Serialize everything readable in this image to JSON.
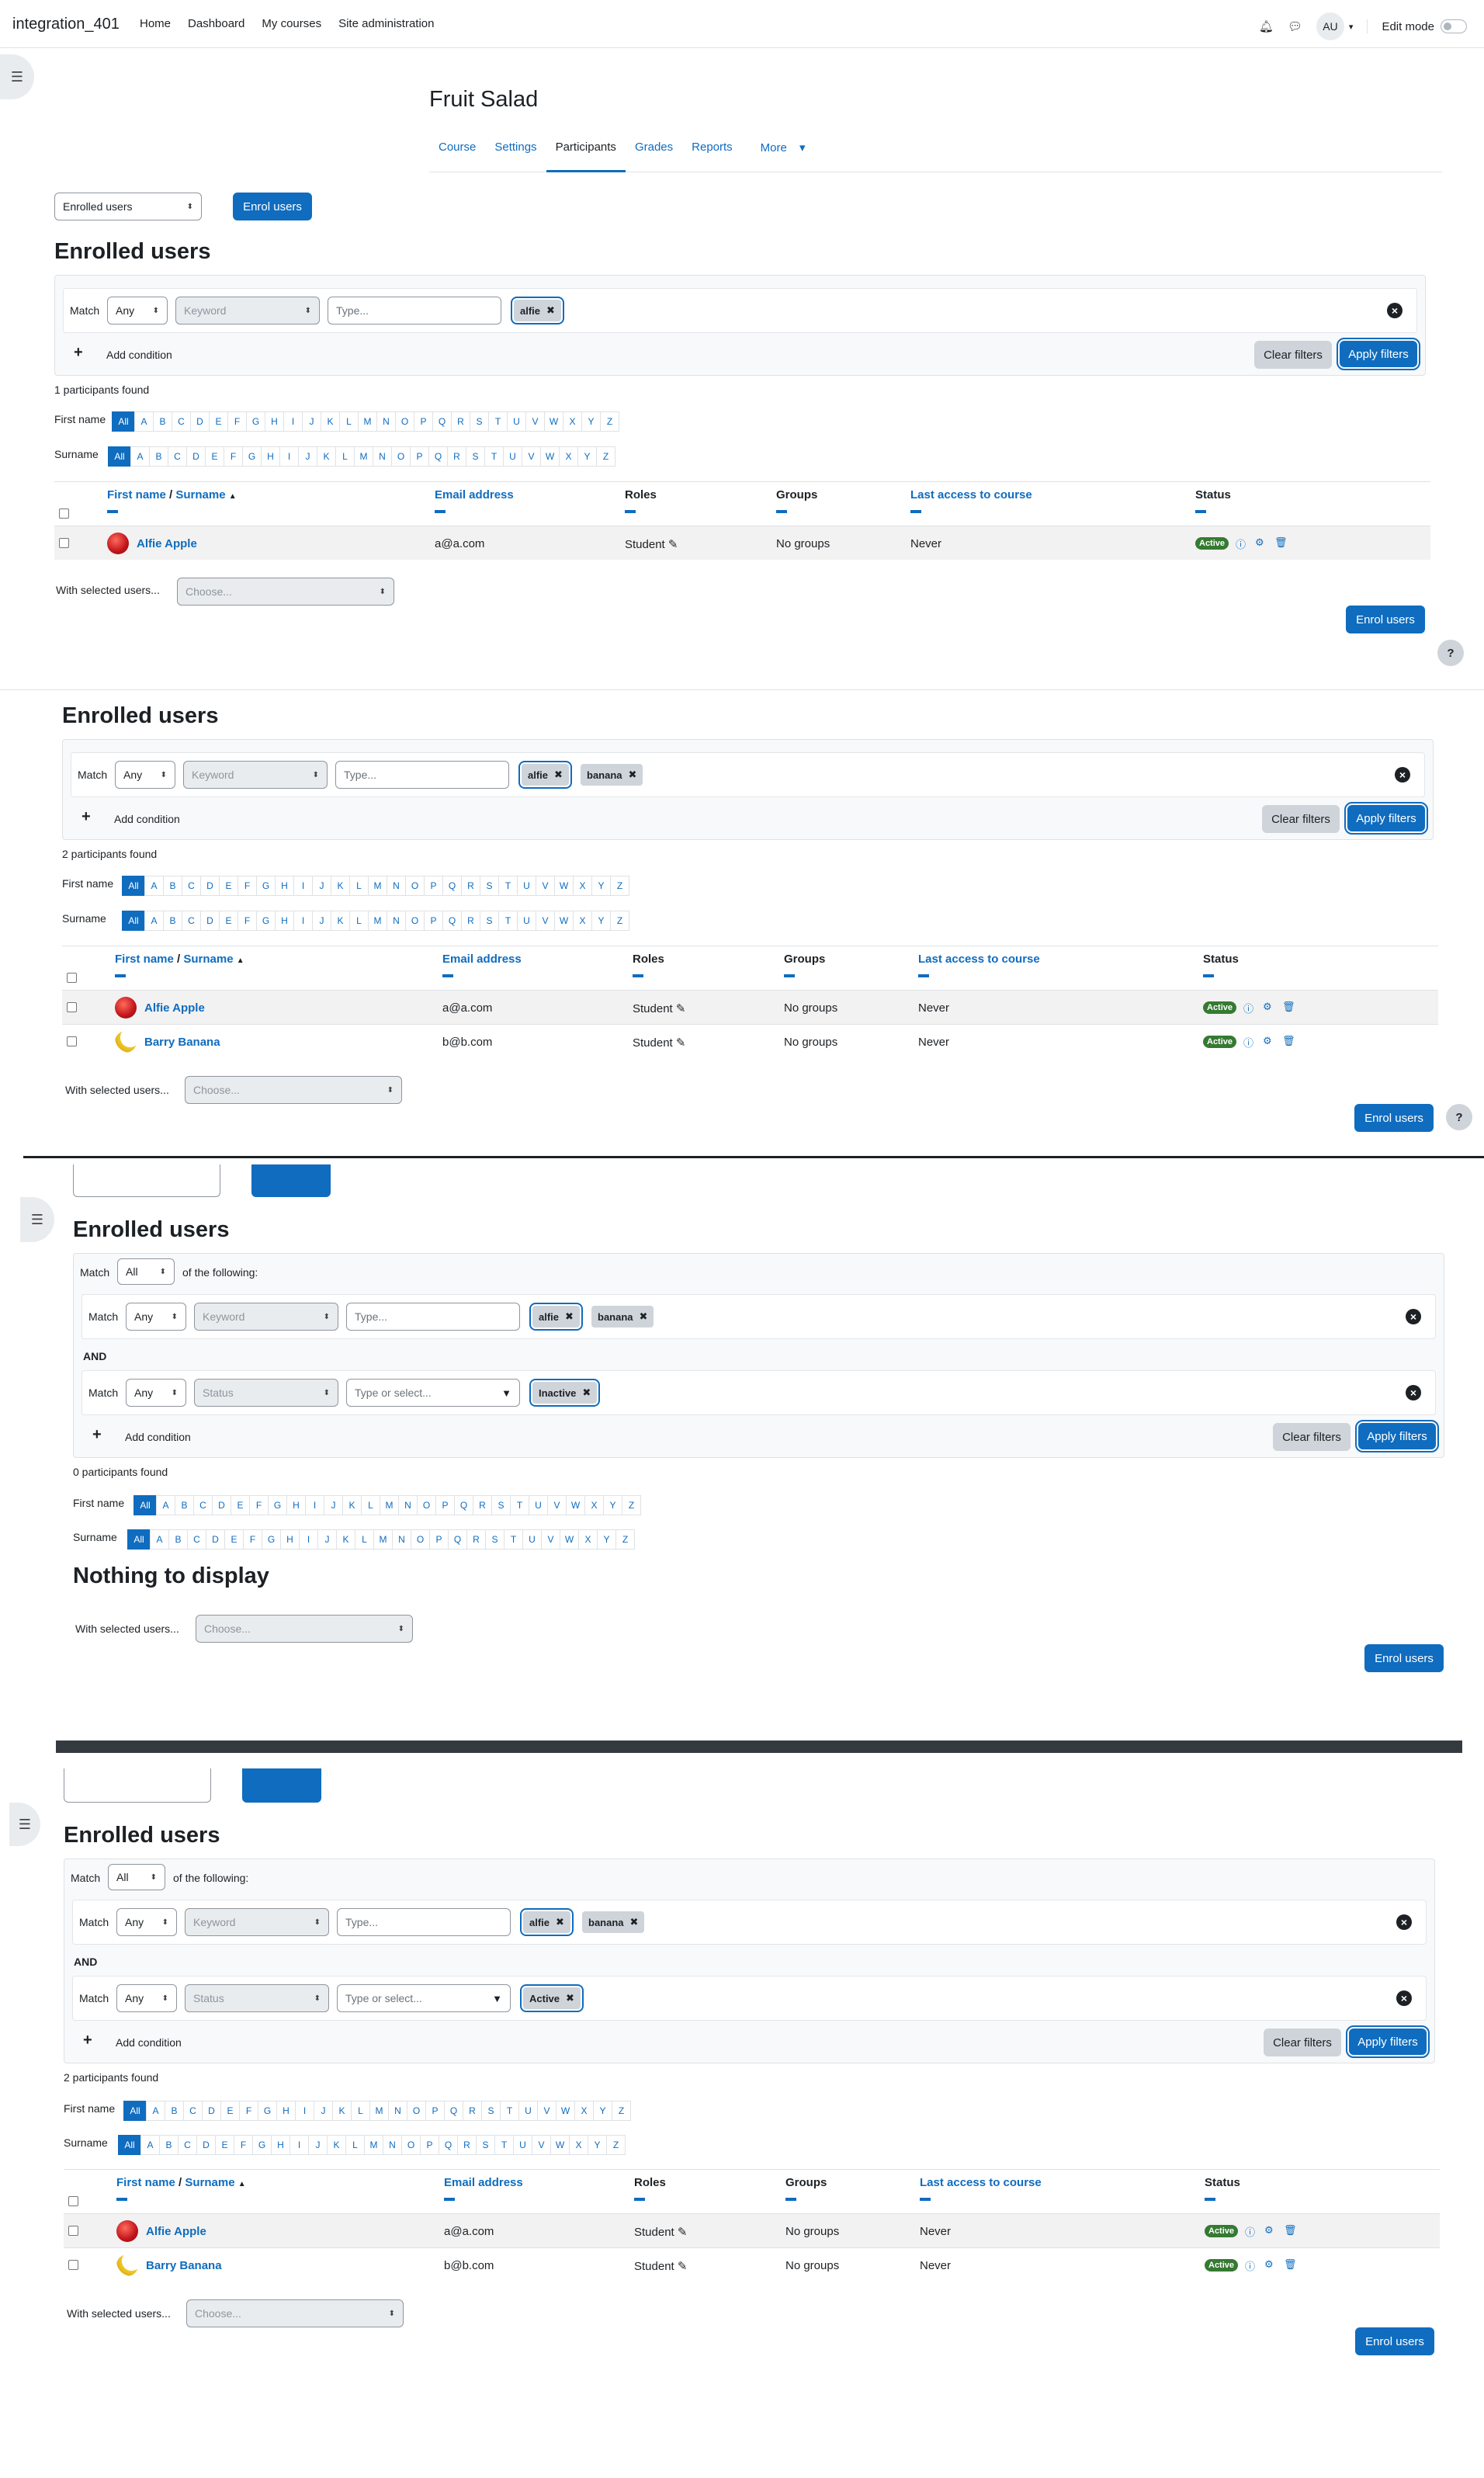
{
  "navbar": {
    "brand": "integration_401",
    "links": [
      "Home",
      "Dashboard",
      "My courses",
      "Site administration"
    ],
    "avatar": "AU",
    "edit_mode": "Edit mode"
  },
  "course": {
    "title": "Fruit Salad",
    "tabs": [
      "Course",
      "Settings",
      "Participants",
      "Grades",
      "Reports",
      "More"
    ]
  },
  "common": {
    "enrolled_users_select": "Enrolled users",
    "enrol_button": "Enrol users",
    "heading": "Enrolled users",
    "match": "Match",
    "any": "Any",
    "all": "All",
    "of_following": "of the following:",
    "and": "AND",
    "keyword_placeholder": "Keyword",
    "status_placeholder": "Status",
    "type_placeholder": "Type...",
    "type_select_placeholder": "Type or select...",
    "add_condition": "Add condition",
    "clear_filters": "Clear filters",
    "apply_filters": "Apply filters",
    "first_name_label": "First name",
    "surname_label": "Surname",
    "letters": [
      "All",
      "A",
      "B",
      "C",
      "D",
      "E",
      "F",
      "G",
      "H",
      "I",
      "J",
      "K",
      "L",
      "M",
      "N",
      "O",
      "P",
      "Q",
      "R",
      "S",
      "T",
      "U",
      "V",
      "W",
      "X",
      "Y",
      "Z"
    ],
    "with_selected": "With selected users...",
    "choose": "Choose...",
    "nothing": "Nothing to display",
    "help": "?"
  },
  "table": {
    "col_first": "First name",
    "col_sep": " / ",
    "col_surname": "Surname",
    "col_email": "Email address",
    "col_roles": "Roles",
    "col_groups": "Groups",
    "col_access": "Last access to course",
    "col_status": "Status"
  },
  "users": {
    "alfie": {
      "name": "Alfie Apple",
      "email": "a@a.com",
      "role": "Student",
      "groups": "No groups",
      "access": "Never",
      "status": "Active"
    },
    "barry": {
      "name": "Barry Banana",
      "email": "b@b.com",
      "role": "Student",
      "groups": "No groups",
      "access": "Never",
      "status": "Active"
    }
  },
  "panels": {
    "p1": {
      "chip1": "alfie",
      "found": "1 participants found"
    },
    "p2": {
      "chip1": "alfie",
      "chip2": "banana",
      "found": "2 participants found"
    },
    "p3": {
      "chip1": "alfie",
      "chip2": "banana",
      "status_chip": "Inactive",
      "found": "0 participants found"
    },
    "p4": {
      "chip1": "alfie",
      "chip2": "banana",
      "status_chip": "Active",
      "found": "2 participants found"
    }
  }
}
